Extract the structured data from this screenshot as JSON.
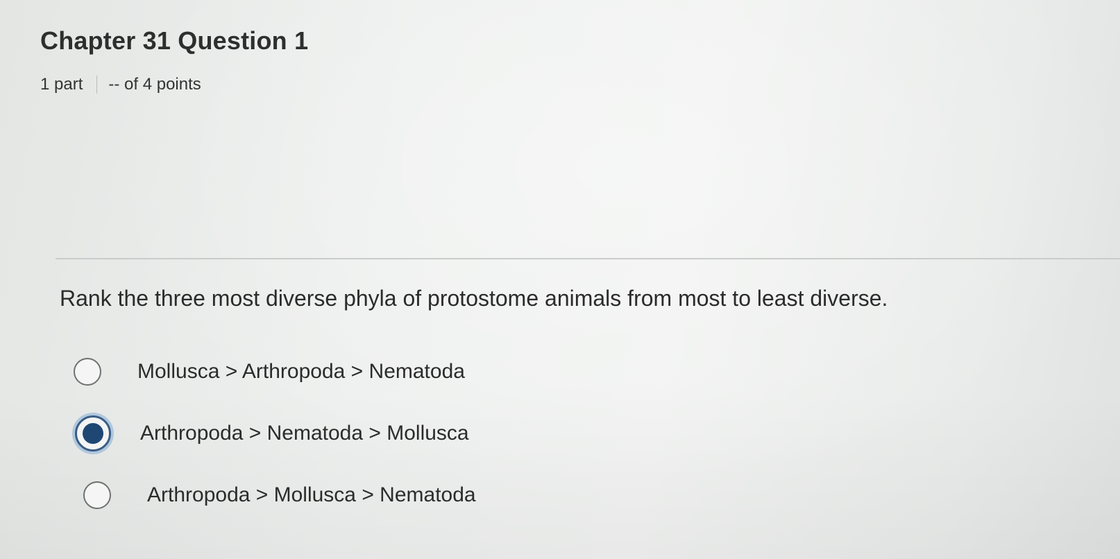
{
  "header": {
    "title": "Chapter 31 Question 1",
    "parts": "1 part",
    "points": "-- of 4 points"
  },
  "question": {
    "prompt": "Rank the three most diverse phyla of protostome animals from most to least diverse.",
    "options": [
      {
        "label": "Mollusca > Arthropoda > Nematoda",
        "selected": false
      },
      {
        "label": "Arthropoda > Nematoda > Mollusca",
        "selected": true
      },
      {
        "label": "Arthropoda > Mollusca > Nematoda",
        "selected": false
      }
    ]
  },
  "colors": {
    "selected_fill": "#1f4774",
    "selected_ring": "#3a5d86",
    "text": "#2b2b2b"
  }
}
